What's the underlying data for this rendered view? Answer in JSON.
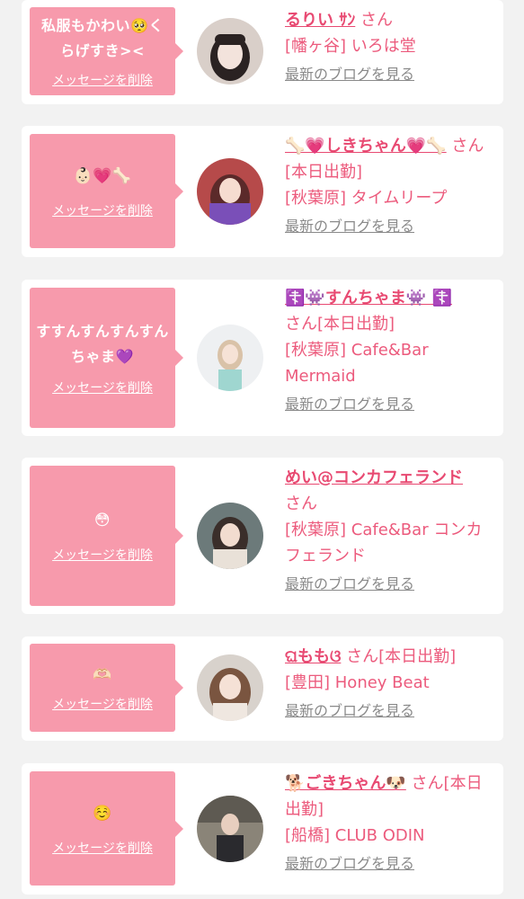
{
  "messages": [
    {
      "bubble_text": "私服もかわい🥺くらげすき><",
      "delete_label": "メッセージを削除",
      "name": "るりい ｻﾝ",
      "suffix": " さん",
      "shop": "[幡ヶ谷] いろは堂",
      "blog_label": "最新のブログを見る"
    },
    {
      "bubble_text": "👶🏻💗🦴",
      "delete_label": "メッセージを削除",
      "name": "🦴💗しきちゃん💗🦴",
      "suffix": " さん[本日出勤]",
      "shop": "[秋葉原] タイムリープ",
      "blog_label": "最新のブログを見る"
    },
    {
      "bubble_text": "すすんすんすんすんちゃま💜",
      "delete_label": "メッセージを削除",
      "name": "☦️👾すんちゃま👾 ☦️",
      "suffix": "さん[本日出勤]",
      "shop": "[秋葉原] Cafe&Bar Mermaid",
      "blog_label": "最新のブログを見る"
    },
    {
      "bubble_text": "😳",
      "delete_label": "メッセージを削除",
      "name": "めい@コンカフェランド",
      "suffix": "さん",
      "shop": "[秋葉原] Cafe&Bar コンカフェランド",
      "blog_label": "最新のブログを見る"
    },
    {
      "bubble_text": "🫶🏻",
      "delete_label": "メッセージを削除",
      "name": "ଘももଓ",
      "suffix": " さん[本日出勤]",
      "shop": "[豊田] Honey Beat",
      "blog_label": "最新のブログを見る"
    },
    {
      "bubble_text": "☺️",
      "delete_label": "メッセージを削除",
      "name": "🐕ごきちゃん🐶",
      "suffix": " さん[本日出勤]",
      "shop": "[船橋] CLUB ODIN",
      "blog_label": "最新のブログを見る"
    }
  ],
  "colors": {
    "bubble": "#f79aac",
    "name": "#e84a72",
    "text": "#ec5b7d",
    "blog_link": "#8a8a8a",
    "background": "#f2f2f2"
  }
}
